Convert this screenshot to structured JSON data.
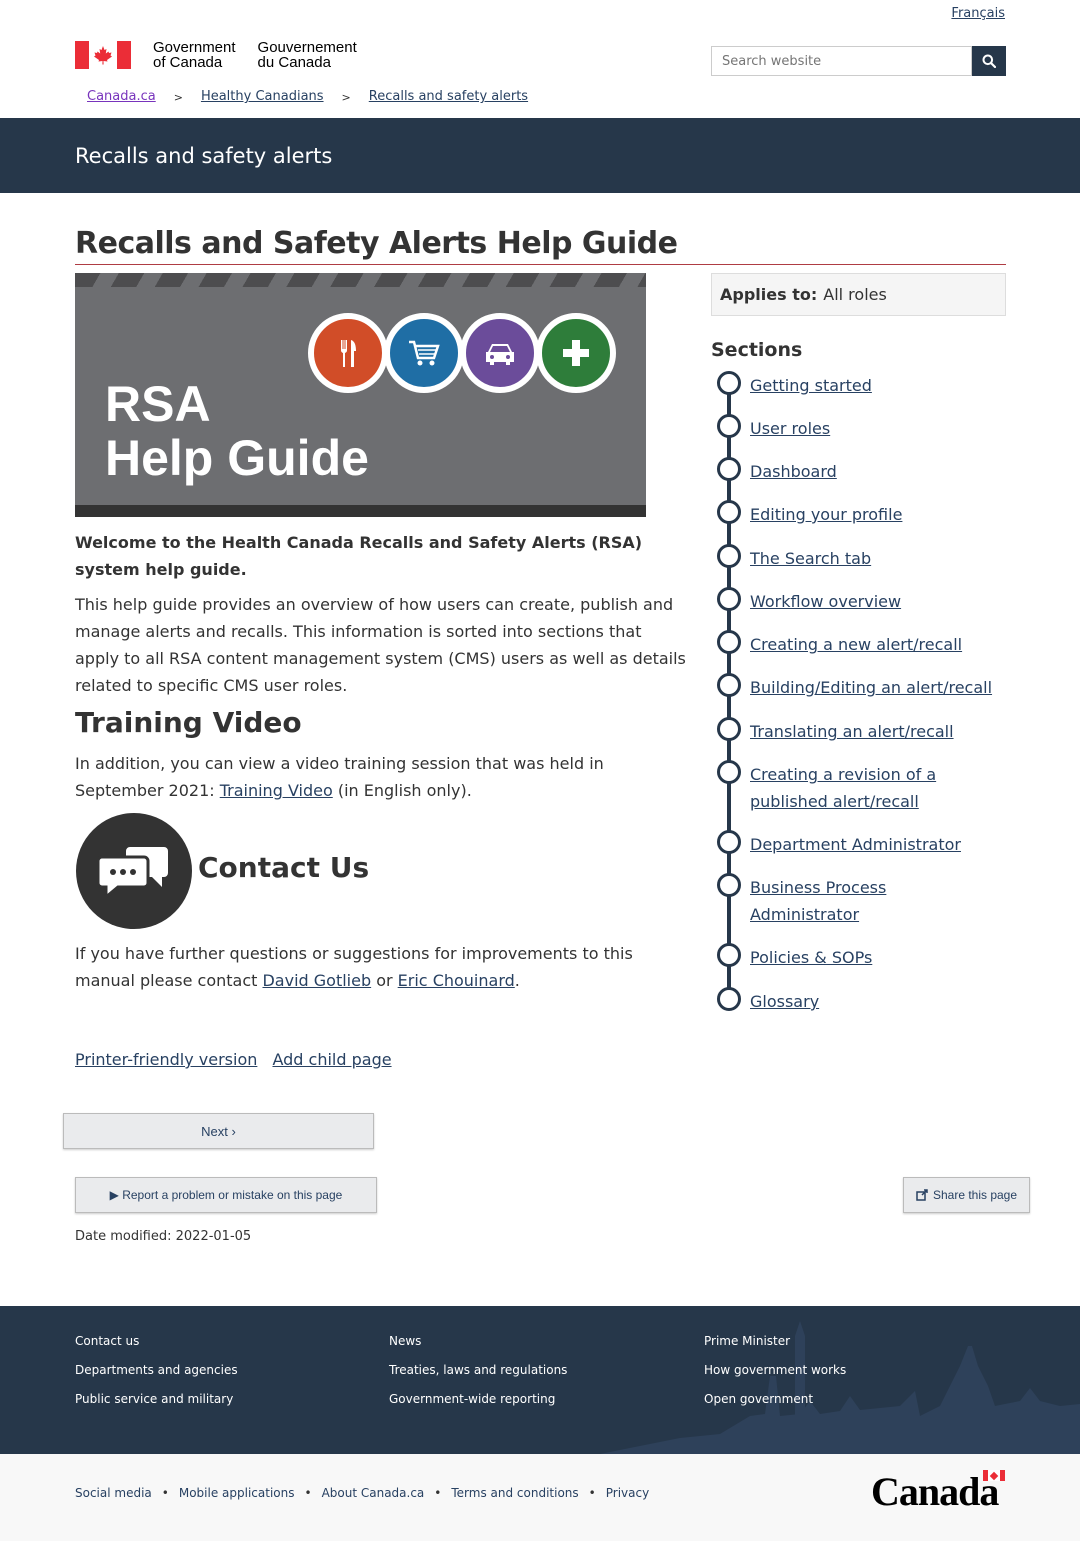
{
  "header": {
    "language_toggle": "Français",
    "brand_en_1": "Government",
    "brand_en_2": "of Canada",
    "brand_fr_1": "Gouvernement",
    "brand_fr_2": "du Canada",
    "search_placeholder": "Search website"
  },
  "breadcrumb": [
    "Canada.ca",
    "Healthy Canadians",
    "Recalls and safety alerts"
  ],
  "banner_title": "Recalls and safety alerts",
  "page_title": "Recalls and Safety Alerts Help Guide",
  "hero": {
    "line1": "RSA",
    "line2": "Help Guide"
  },
  "intro_bold": "Welcome to the Health Canada Recalls and Safety Alerts (RSA) system help guide.",
  "intro": "This help guide provides an overview of how users can create, publish and manage alerts and recalls. This information is sorted into sections that apply to all RSA content management system (CMS) users as well as details related to specific CMS user roles.",
  "training": {
    "heading": "Training Video",
    "text_before": "In addition, you can view a video training session that was held in September 2021: ",
    "link": "Training Video",
    "text_after": " (in English only)."
  },
  "contact": {
    "heading": "Contact Us",
    "text_before": "If you have further questions or suggestions for improvements to this manual please contact ",
    "link1": "David Gotlieb",
    "middle": " or ",
    "link2": "Eric Chouinard",
    "end": "."
  },
  "page_links": {
    "printer": "Printer-friendly version",
    "add_child": "Add child page"
  },
  "buttons": {
    "next": "Next ›",
    "report": "▶ Report a problem or mistake on this page",
    "share": "Share this page"
  },
  "date_modified": "Date modified: 2022-01-05",
  "sidebar": {
    "applies_label": "Applies to:",
    "applies_value": "All roles",
    "sections_heading": "Sections",
    "items": [
      "Getting started",
      "User roles",
      "Dashboard",
      "Editing your profile",
      "The Search tab",
      "Workflow overview",
      "Creating a new alert/recall",
      "Building/Editing an alert/recall",
      "Translating an alert/recall",
      "Creating a revision of a published alert/recall",
      "Department Administrator",
      "Business Process Administrator",
      "Policies & SOPs",
      "Glossary"
    ]
  },
  "footer": {
    "col1": [
      "Contact us",
      "Departments and agencies",
      "Public service and military"
    ],
    "col2": [
      "News",
      "Treaties, laws and regulations",
      "Government-wide reporting"
    ],
    "col3": [
      "Prime Minister",
      "How government works",
      "Open government"
    ],
    "sub_links": [
      "Social media",
      "Mobile applications",
      "About Canada.ca",
      "Terms and conditions",
      "Privacy"
    ],
    "wordmark": "Canada"
  },
  "colors": {
    "navy": "#26374a",
    "link": "#284162",
    "red": "#eb2d37",
    "title_rule": "#af3c43"
  },
  "icons": [
    "maple-leaf-icon",
    "search-icon",
    "fork-knife-icon",
    "cart-icon",
    "car-icon",
    "plus-icon",
    "chat-bubbles-icon",
    "share-icon"
  ]
}
